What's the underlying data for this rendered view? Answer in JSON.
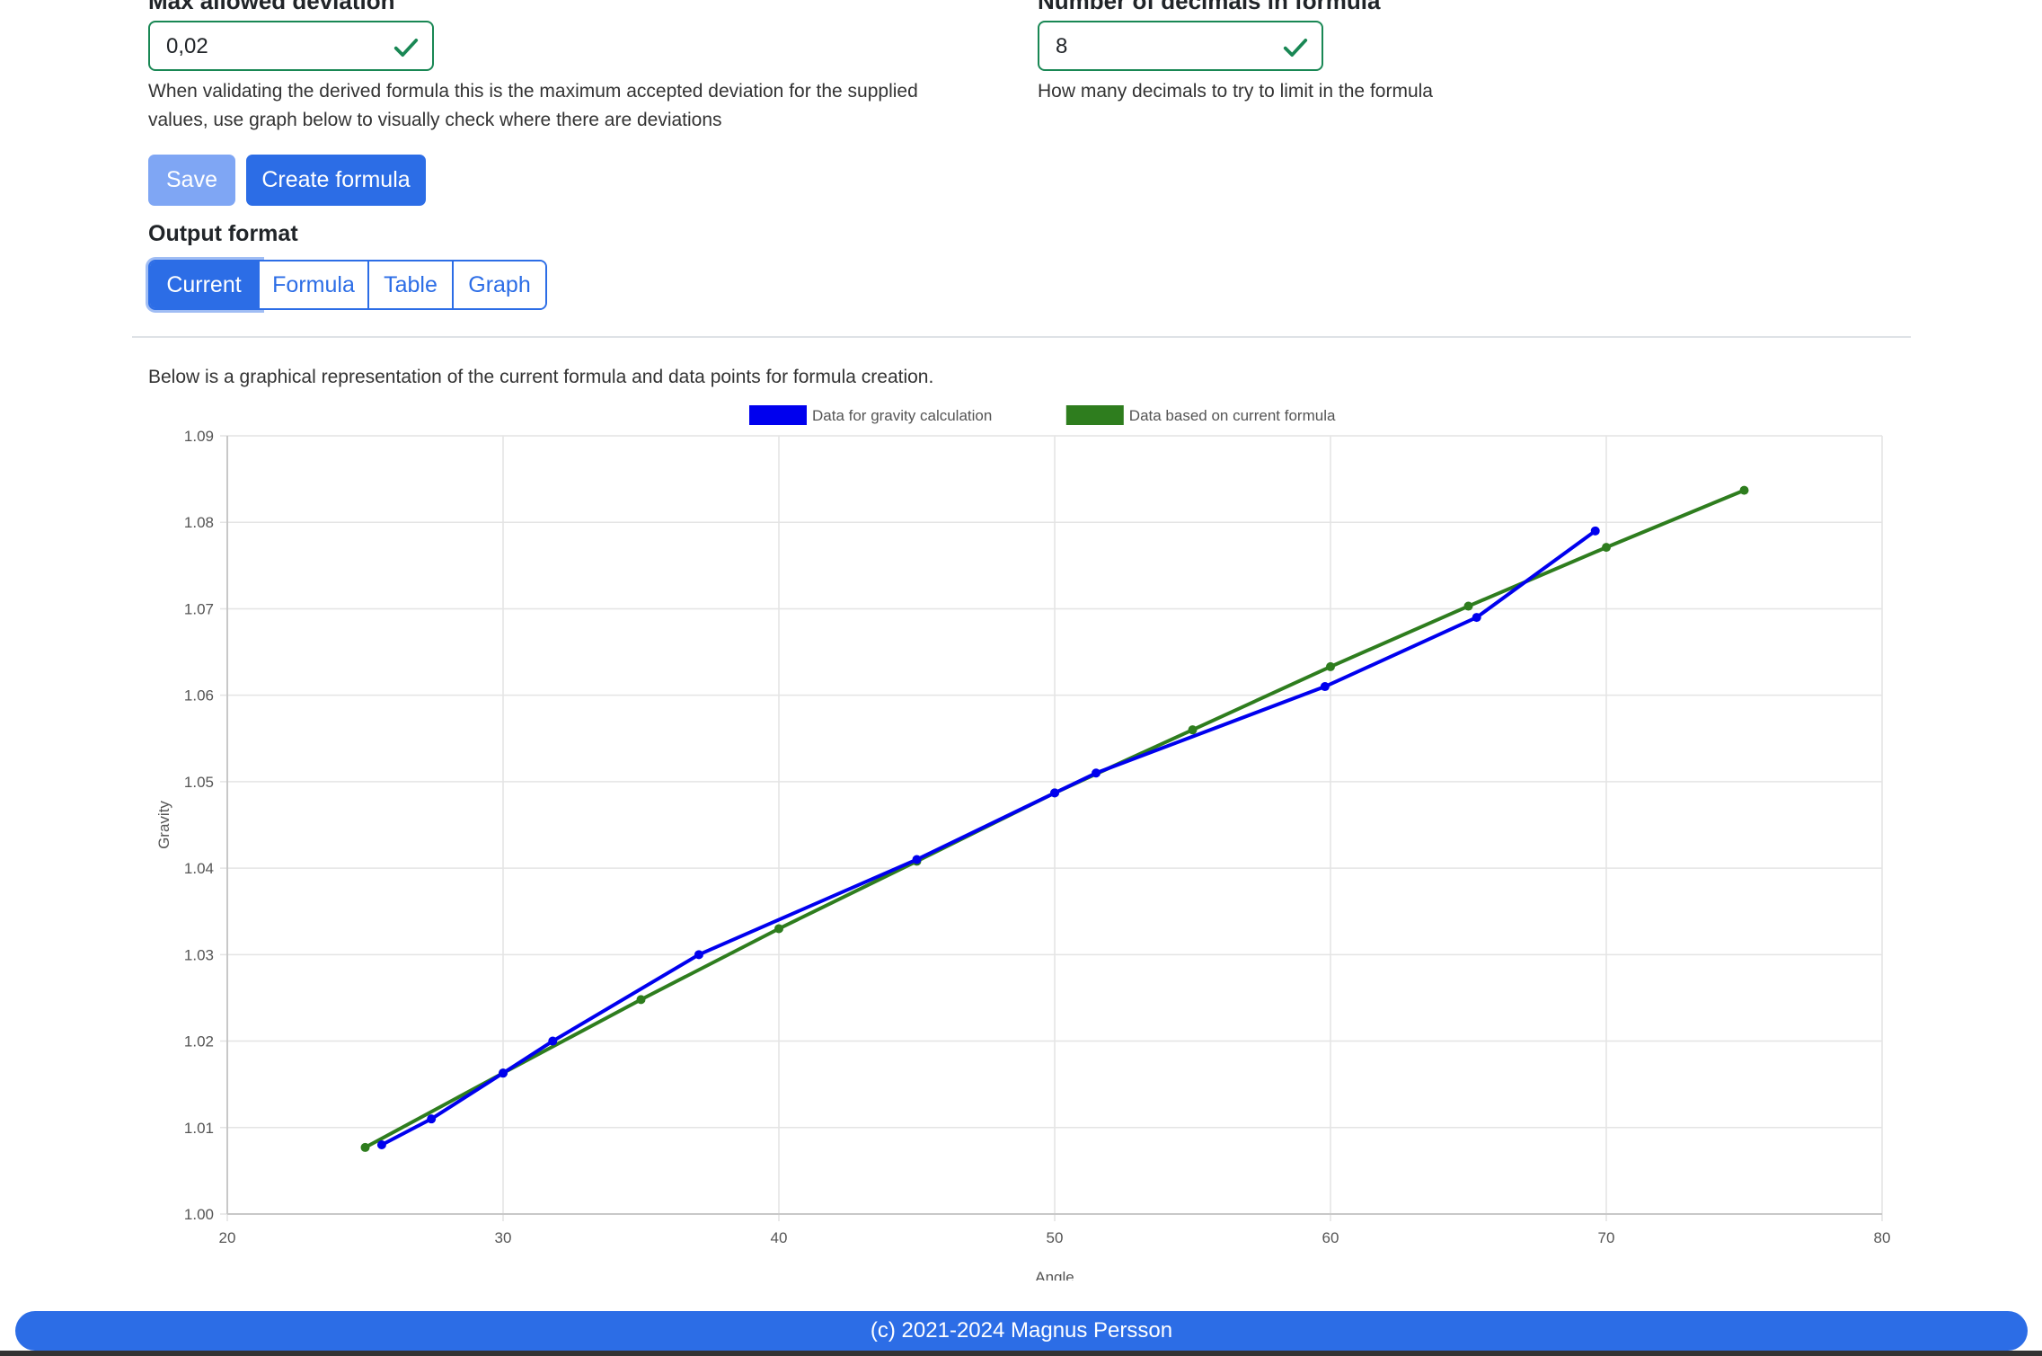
{
  "deviation": {
    "label": "Max allowed deviation",
    "value": "0,02",
    "help_line1": "When validating the derived formula this is the maximum accepted deviation for the supplied",
    "help_line2": "values, use graph below to visually check where there are deviations"
  },
  "decimals": {
    "label": "Number of decimals in formula",
    "value": "8",
    "help": "How many decimals to try to limit in the formula"
  },
  "buttons": {
    "save": "Save",
    "create": "Create formula"
  },
  "output_format": {
    "title": "Output format",
    "tabs": [
      "Current",
      "Formula",
      "Table",
      "Graph"
    ],
    "active": "Current"
  },
  "graph_description": "Below is a graphical representation of the current formula and data points for formula creation.",
  "footer": "(c) 2021-2024 Magnus Persson",
  "colors": {
    "accent": "#2c6de6",
    "valid": "#198754"
  },
  "icons": {
    "valid": "check-icon"
  },
  "chart_data": {
    "type": "line",
    "xlabel": "Angle",
    "ylabel": "Gravity",
    "xlim": [
      20,
      80
    ],
    "ylim": [
      1.0,
      1.09
    ],
    "xticks": [
      "20",
      "30",
      "40",
      "50",
      "60",
      "70",
      "80"
    ],
    "yticks": [
      "1.00",
      "1.01",
      "1.02",
      "1.03",
      "1.04",
      "1.05",
      "1.06",
      "1.07",
      "1.08",
      "1.09"
    ],
    "grid": true,
    "legend": "top-center",
    "series": [
      {
        "name": "Data for gravity calculation",
        "color": "#0000ee",
        "x": [
          25.6,
          27.4,
          30.0,
          31.8,
          37.1,
          45.0,
          50.0,
          51.5,
          59.8,
          65.3,
          69.6
        ],
        "y": [
          1.008,
          1.011,
          1.0163,
          1.02,
          1.03,
          1.041,
          1.0487,
          1.051,
          1.061,
          1.069,
          1.079
        ]
      },
      {
        "name": "Data based on current formula",
        "color": "#2e7d1e",
        "x": [
          25,
          30,
          35,
          40,
          45,
          50,
          55,
          60,
          65,
          70,
          75
        ],
        "y": [
          1.0077,
          1.0163,
          1.0248,
          1.033,
          1.0408,
          1.0487,
          1.056,
          1.0633,
          1.0703,
          1.0771,
          1.0837
        ]
      }
    ]
  }
}
